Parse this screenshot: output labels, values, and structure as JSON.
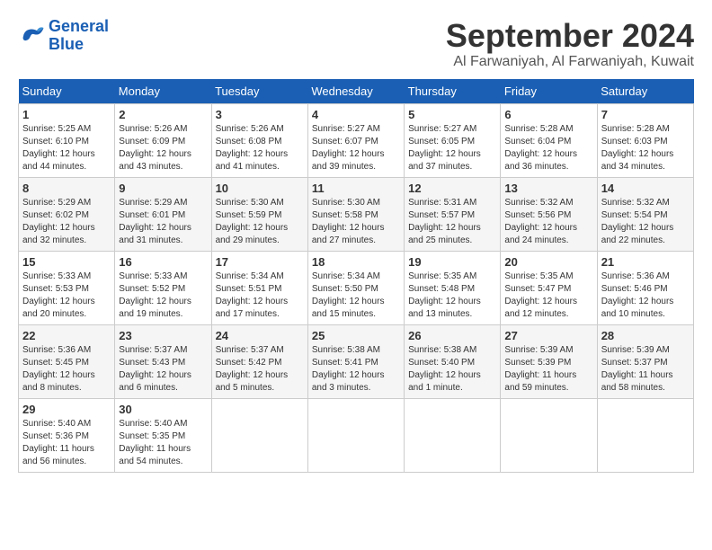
{
  "header": {
    "logo": {
      "line1": "General",
      "line2": "Blue"
    },
    "month": "September 2024",
    "location": "Al Farwaniyah, Al Farwaniyah, Kuwait"
  },
  "weekdays": [
    "Sunday",
    "Monday",
    "Tuesday",
    "Wednesday",
    "Thursday",
    "Friday",
    "Saturday"
  ],
  "weeks": [
    [
      {
        "day": "1",
        "sunrise": "5:25 AM",
        "sunset": "6:10 PM",
        "daylight": "12 hours and 44 minutes."
      },
      {
        "day": "2",
        "sunrise": "5:26 AM",
        "sunset": "6:09 PM",
        "daylight": "12 hours and 43 minutes."
      },
      {
        "day": "3",
        "sunrise": "5:26 AM",
        "sunset": "6:08 PM",
        "daylight": "12 hours and 41 minutes."
      },
      {
        "day": "4",
        "sunrise": "5:27 AM",
        "sunset": "6:07 PM",
        "daylight": "12 hours and 39 minutes."
      },
      {
        "day": "5",
        "sunrise": "5:27 AM",
        "sunset": "6:05 PM",
        "daylight": "12 hours and 37 minutes."
      },
      {
        "day": "6",
        "sunrise": "5:28 AM",
        "sunset": "6:04 PM",
        "daylight": "12 hours and 36 minutes."
      },
      {
        "day": "7",
        "sunrise": "5:28 AM",
        "sunset": "6:03 PM",
        "daylight": "12 hours and 34 minutes."
      }
    ],
    [
      {
        "day": "8",
        "sunrise": "5:29 AM",
        "sunset": "6:02 PM",
        "daylight": "12 hours and 32 minutes."
      },
      {
        "day": "9",
        "sunrise": "5:29 AM",
        "sunset": "6:01 PM",
        "daylight": "12 hours and 31 minutes."
      },
      {
        "day": "10",
        "sunrise": "5:30 AM",
        "sunset": "5:59 PM",
        "daylight": "12 hours and 29 minutes."
      },
      {
        "day": "11",
        "sunrise": "5:30 AM",
        "sunset": "5:58 PM",
        "daylight": "12 hours and 27 minutes."
      },
      {
        "day": "12",
        "sunrise": "5:31 AM",
        "sunset": "5:57 PM",
        "daylight": "12 hours and 25 minutes."
      },
      {
        "day": "13",
        "sunrise": "5:32 AM",
        "sunset": "5:56 PM",
        "daylight": "12 hours and 24 minutes."
      },
      {
        "day": "14",
        "sunrise": "5:32 AM",
        "sunset": "5:54 PM",
        "daylight": "12 hours and 22 minutes."
      }
    ],
    [
      {
        "day": "15",
        "sunrise": "5:33 AM",
        "sunset": "5:53 PM",
        "daylight": "12 hours and 20 minutes."
      },
      {
        "day": "16",
        "sunrise": "5:33 AM",
        "sunset": "5:52 PM",
        "daylight": "12 hours and 19 minutes."
      },
      {
        "day": "17",
        "sunrise": "5:34 AM",
        "sunset": "5:51 PM",
        "daylight": "12 hours and 17 minutes."
      },
      {
        "day": "18",
        "sunrise": "5:34 AM",
        "sunset": "5:50 PM",
        "daylight": "12 hours and 15 minutes."
      },
      {
        "day": "19",
        "sunrise": "5:35 AM",
        "sunset": "5:48 PM",
        "daylight": "12 hours and 13 minutes."
      },
      {
        "day": "20",
        "sunrise": "5:35 AM",
        "sunset": "5:47 PM",
        "daylight": "12 hours and 12 minutes."
      },
      {
        "day": "21",
        "sunrise": "5:36 AM",
        "sunset": "5:46 PM",
        "daylight": "12 hours and 10 minutes."
      }
    ],
    [
      {
        "day": "22",
        "sunrise": "5:36 AM",
        "sunset": "5:45 PM",
        "daylight": "12 hours and 8 minutes."
      },
      {
        "day": "23",
        "sunrise": "5:37 AM",
        "sunset": "5:43 PM",
        "daylight": "12 hours and 6 minutes."
      },
      {
        "day": "24",
        "sunrise": "5:37 AM",
        "sunset": "5:42 PM",
        "daylight": "12 hours and 5 minutes."
      },
      {
        "day": "25",
        "sunrise": "5:38 AM",
        "sunset": "5:41 PM",
        "daylight": "12 hours and 3 minutes."
      },
      {
        "day": "26",
        "sunrise": "5:38 AM",
        "sunset": "5:40 PM",
        "daylight": "12 hours and 1 minute."
      },
      {
        "day": "27",
        "sunrise": "5:39 AM",
        "sunset": "5:39 PM",
        "daylight": "11 hours and 59 minutes."
      },
      {
        "day": "28",
        "sunrise": "5:39 AM",
        "sunset": "5:37 PM",
        "daylight": "11 hours and 58 minutes."
      }
    ],
    [
      {
        "day": "29",
        "sunrise": "5:40 AM",
        "sunset": "5:36 PM",
        "daylight": "11 hours and 56 minutes."
      },
      {
        "day": "30",
        "sunrise": "5:40 AM",
        "sunset": "5:35 PM",
        "daylight": "11 hours and 54 minutes."
      },
      null,
      null,
      null,
      null,
      null
    ]
  ]
}
